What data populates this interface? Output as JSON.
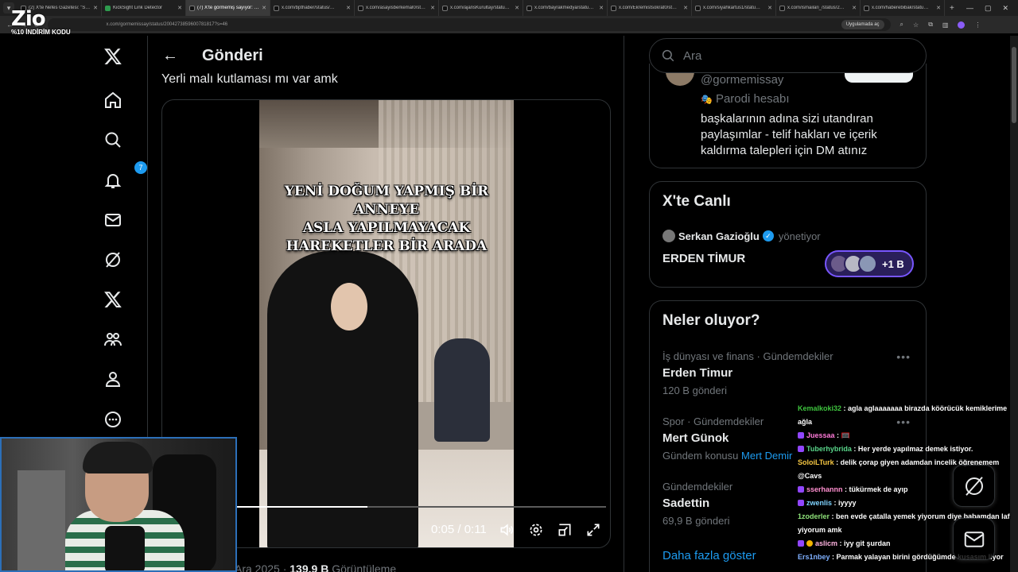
{
  "browser": {
    "tabs": [
      {
        "label": "(2) X'te Nefes Gazetesi: \"S…",
        "fav": "x",
        "active": false
      },
      {
        "label": "KickSight Link Detector",
        "fav": "green",
        "active": false
      },
      {
        "label": "(7) X'te görmemiş sayıyor: …",
        "fav": "x",
        "active": true
      },
      {
        "label": "x.com/bpthaber/status/…",
        "fav": "x",
        "active": false
      },
      {
        "label": "x.com/asayisberkemal0/st…",
        "fav": "x",
        "active": false
      },
      {
        "label": "x.com/ajansKurultay/statu…",
        "fav": "x",
        "active": false
      },
      {
        "label": "x.com/bayrakmedya/statu…",
        "fav": "x",
        "active": false
      },
      {
        "label": "x.com/Ekremistsokrat0/st…",
        "fav": "x",
        "active": false
      },
      {
        "label": "x.com/siyahkartus1/statu…",
        "fav": "x",
        "active": false
      },
      {
        "label": "x.com/ismailari_/status/2…",
        "fav": "x",
        "active": false
      },
      {
        "label": "x.com/haberebibak/statu…",
        "fav": "x",
        "active": false
      }
    ],
    "url": "x.com/gormemissay/status/2004273859600781817?s=46",
    "app_button": "Uygulamada aç"
  },
  "overlay": {
    "logo_text": "Zio",
    "promo": "%10 İNDİRİM KODU"
  },
  "nav": {
    "notifications_badge": "7",
    "icons": [
      "x-logo-icon",
      "home-icon",
      "search-icon",
      "bell-icon",
      "mail-icon",
      "grok-icon",
      "premium-x-icon",
      "communities-icon",
      "profile-icon",
      "more-icon"
    ]
  },
  "post": {
    "header_title": "Gönderi",
    "text": "Yerli malı kutlaması mı var amk",
    "video_caption": "YENİ DOĞUM YAPMIŞ BİR\nANNEYE\nASLA YAPILMAYACAK\nHAREKETLER BİR ARADA",
    "time": "0:05 / 0:11",
    "progress": 0.36,
    "date_prefix": "Ara 2025 · ",
    "views_count": "139,9 B",
    "views_label": " Görüntüleme"
  },
  "sidebar": {
    "search_placeholder": "Ara",
    "profile": {
      "handle": "@gormemissay",
      "parody": "Parodi hesabı",
      "bio": "başkalarının adına sizi utandıran paylaşımlar - telif hakları ve içerik kaldırma talepleri için DM atınız"
    },
    "live": {
      "title": "X'te Canlı",
      "host": "Serkan Gazioğlu",
      "role": "yönetiyor",
      "topic": "ERDEN TİMUR",
      "listeners": "+1 B"
    },
    "trends": {
      "title": "Neler oluyor?",
      "items": [
        {
          "context": "İş dünyası ve finans · Gündemdekiler",
          "name": "Erden Timur",
          "meta": "120 B gönderi",
          "link": ""
        },
        {
          "context": "Spor · Gündemdekiler",
          "name": "Mert Günok",
          "meta": "Gündem konusu ",
          "link": "Mert Demir"
        },
        {
          "context": "Gündemdekiler",
          "name": "Sadettin",
          "meta": "69,9 B gönderi",
          "link": ""
        }
      ],
      "show_more": "Daha fazla göster"
    }
  },
  "chat": [
    {
      "user": "Kemalkoki32",
      "color": "#3ec43e",
      "badge": "",
      "text": " : agla aglaaaaaaa birazda köörücük kemiklerime ağla"
    },
    {
      "user": "Juessaa",
      "color": "#ff7ad9",
      "badge": "purple",
      "text": " : 🥅"
    },
    {
      "user": "Tuberhybrida",
      "color": "#59d68a",
      "badge": "purple",
      "text": " : Her yerde yapılmaz demek istiyor."
    },
    {
      "user": "SoloiLTurk",
      "color": "#f4c542",
      "badge": "",
      "text": " : delik çorap giyen adamdan incelik öğrenemem @Cavs"
    },
    {
      "user": "sserhannn",
      "color": "#ff8fd0",
      "badge": "purple",
      "text": " : tükürmek de ayıp"
    },
    {
      "user": "zwenlis",
      "color": "#7fd3ff",
      "badge": "purple",
      "text": " : iyyyy"
    },
    {
      "user": "1zoderler",
      "color": "#8fe37a",
      "badge": "",
      "text": " : ben evde çatalla yemek yiyorum diye babamdan laf yiyorum amk"
    },
    {
      "user": "aslicm",
      "color": "#ffb3e0",
      "badge": "both",
      "text": " : iyy git şurdan"
    },
    {
      "user": "Ers1nbey",
      "color": "#7fb0ff",
      "badge": "",
      "text": " : Parmak yalayan birini gördüğümde kusasım liyor"
    }
  ]
}
